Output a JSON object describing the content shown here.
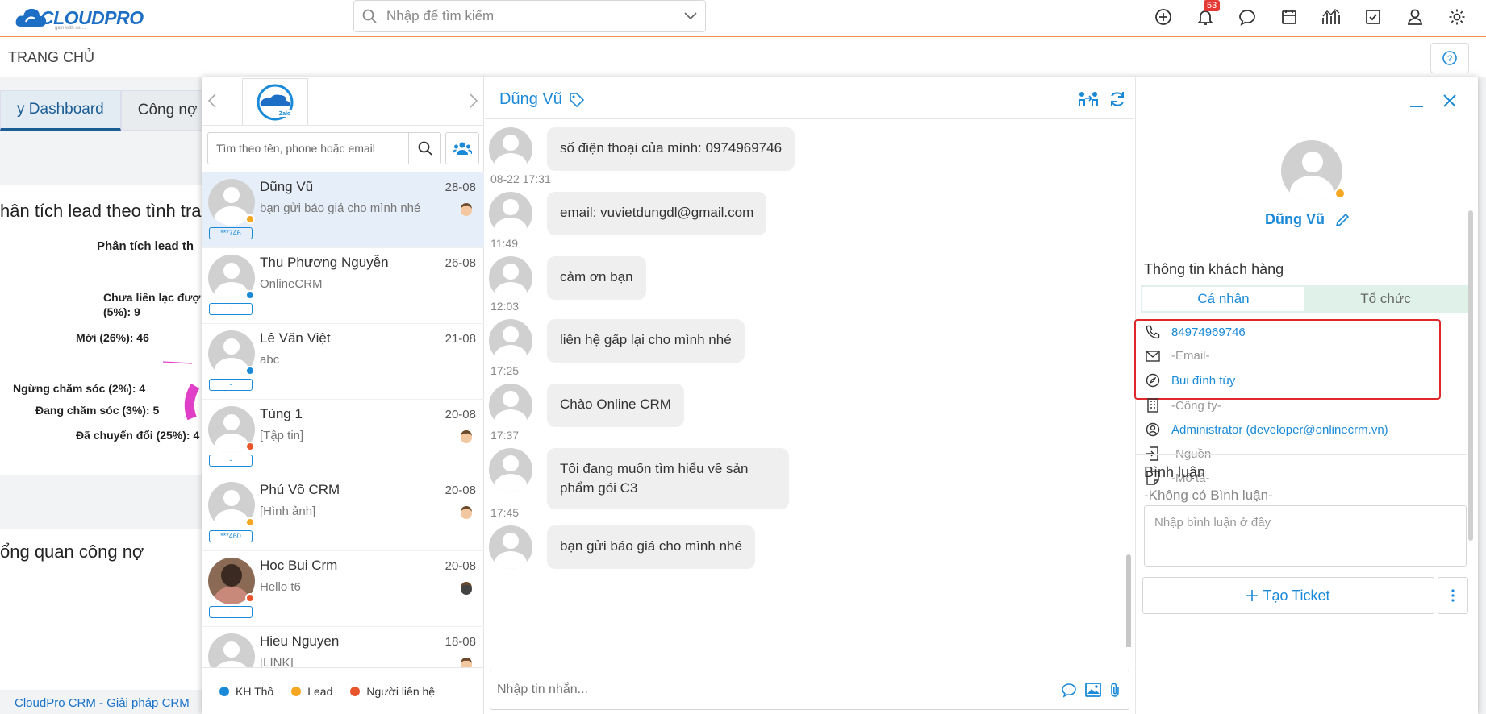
{
  "app": {
    "logo_text_main": "CLOUDPRO",
    "logo_tagline": "gain with us ..."
  },
  "search": {
    "placeholder": "Nhập để tìm kiếm"
  },
  "topbar": {
    "notification_count": "53"
  },
  "page": {
    "title": "TRANG CHỦ",
    "footer": "CloudPro CRM - Giải pháp CRM"
  },
  "dashboard": {
    "tabs": [
      "y Dashboard",
      "Công nợ"
    ],
    "panel1_title": "hân tích lead theo tình tra",
    "panel1_chart_title": "Phân tích lead th",
    "chart_labels": [
      "Chưa liên lạc đượ",
      "(5%): 9",
      "Mới (26%): 46",
      "Ngừng chăm sóc (2%): 4",
      "Đang chăm sóc (3%): 5",
      "Đã chuyển đổi (25%): 4"
    ],
    "panel2_title": "ổng quan công nợ"
  },
  "chat_search": {
    "placeholder": "Tìm theo tên, phone hoặc email"
  },
  "contacts": [
    {
      "name": "Dũng Vũ",
      "date": "28-08",
      "message": "bạn gửi báo giá cho mình nhé",
      "chip": "***746",
      "status": "#f5a623",
      "selected": true,
      "face": true
    },
    {
      "name": "Thu Phương Nguyễn",
      "date": "26-08",
      "message": "OnlineCRM",
      "chip": "-",
      "status": "#1a8ad8",
      "selected": false,
      "face": false
    },
    {
      "name": "Lê Văn Việt",
      "date": "21-08",
      "message": "abc",
      "chip": "-",
      "status": "#1a8ad8",
      "selected": false,
      "face": false
    },
    {
      "name": "Tùng 1",
      "date": "20-08",
      "message": "[Tập tin]",
      "chip": "-",
      "status": "#e8552c",
      "selected": false,
      "face": true
    },
    {
      "name": "Phú Võ CRM",
      "date": "20-08",
      "message": "[Hình ảnh]",
      "chip": "***460",
      "status": "#f5a623",
      "selected": false,
      "face": true
    },
    {
      "name": "Hoc Bui Crm",
      "date": "20-08",
      "message": "Hello t6",
      "chip": "-",
      "status": "#e8552c",
      "selected": false,
      "face": true,
      "photo": true
    },
    {
      "name": "Hieu Nguyen",
      "date": "18-08",
      "message": "[LINK]",
      "chip": "-",
      "status": "#f5a623",
      "selected": false,
      "face": true
    }
  ],
  "legend": [
    {
      "label": "KH Thô",
      "color": "#1a8ad8"
    },
    {
      "label": "Lead",
      "color": "#f5a623"
    },
    {
      "label": "Người liên hệ",
      "color": "#e8552c"
    }
  ],
  "chat": {
    "contact_name": "Dũng Vũ",
    "messages": [
      {
        "time": "",
        "text": "số điện thoại của mình: 0974969746"
      },
      {
        "time": "08-22 17:31",
        "text": "email: vuvietdungdl@gmail.com"
      },
      {
        "time": "11:49",
        "text": "cảm ơn bạn"
      },
      {
        "time": "12:03",
        "text": "liên hệ gấp lại cho mình nhé"
      },
      {
        "time": "17:25",
        "text": "Chào Online CRM"
      },
      {
        "time": "17:37",
        "text": "Tôi đang muốn tìm hiểu về sản phẩm gói C3"
      },
      {
        "time": "17:45",
        "text": "bạn gửi báo giá cho mình nhé"
      }
    ],
    "input_placeholder": "Nhập tin nhắn..."
  },
  "profile": {
    "name": "Dũng Vũ",
    "section_title": "Thông tin khách hàng",
    "tabs": [
      "Cá nhân",
      "Tổ chức"
    ],
    "phone": "84974969746",
    "email": "-Email-",
    "address": "Bui đình túy",
    "company": "-Công ty-",
    "owner": "Administrator (developer@onlinecrm.vn)",
    "source": "-Nguồn-",
    "description": "-Mô tả-",
    "comments_title": "Bình luận",
    "comments_empty": "-Không có Bình luận-",
    "comment_placeholder": "Nhập bình luận ở đây",
    "ticket_button": "Tạo Ticket"
  }
}
